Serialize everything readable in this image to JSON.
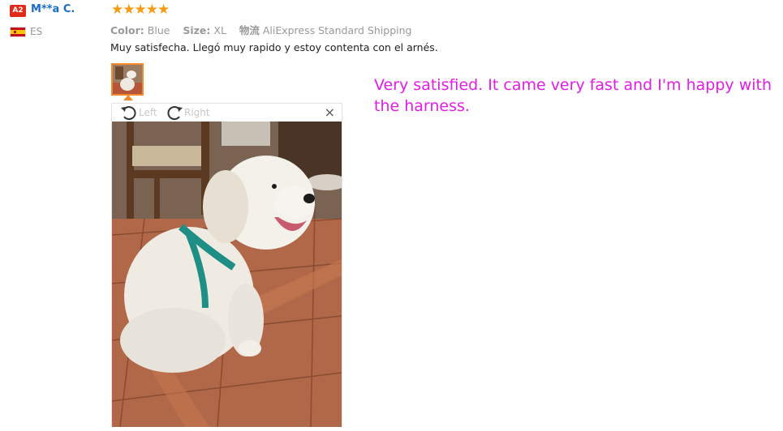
{
  "reviewer": {
    "badge": "A2",
    "name": "M**a C.",
    "country": "ES",
    "flag_icon": "spain-flag-icon"
  },
  "rating": {
    "stars": "★★★★★",
    "value": 5,
    "max": 5,
    "color": "#f39c12"
  },
  "attributes": {
    "color_label": "Color:",
    "color_value": "Blue",
    "size_label": "Size:",
    "size_value": "XL",
    "shipping_label": "物流",
    "shipping_value": "AliExpress Standard Shipping"
  },
  "review_text": "Muy satisfecha. Llegó muy rapido y estoy contenta con el arnés.",
  "viewer": {
    "rotate_left_label": "Left",
    "rotate_right_label": "Right",
    "close_symbol": "×"
  },
  "translation": "Very satisfied. It came very fast and I'm happy with the harness.",
  "colors": {
    "username": "#1a6dc8",
    "badge": "#e02b1a",
    "translation": "#e21de6",
    "thumb_border": "#f08a2d"
  }
}
